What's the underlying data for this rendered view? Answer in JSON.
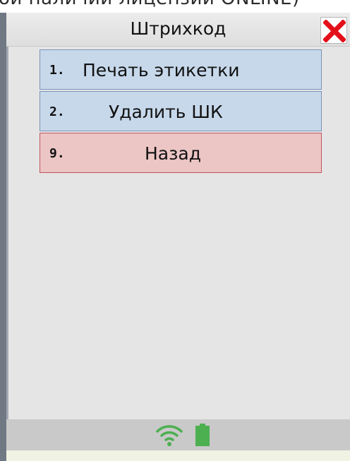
{
  "caption": {
    "text": "ой наличии лицензии ONLINE)"
  },
  "window": {
    "title": "Штрихкод"
  },
  "icons": {
    "close": "close-x-icon",
    "wifi": "wifi-icon",
    "battery": "battery-icon"
  },
  "menu": {
    "items": [
      {
        "number": "1.",
        "label": "Печать этикетки",
        "color": "#c7d8ea"
      },
      {
        "number": "2.",
        "label": "Удалить ШК",
        "color": "#c7d8ea"
      },
      {
        "number": "9.",
        "label": "Назад",
        "color": "#ecc5c5"
      }
    ]
  },
  "colors": {
    "close_x": "#e3101a",
    "status_green": "#4caf50",
    "frame": "#707884"
  }
}
